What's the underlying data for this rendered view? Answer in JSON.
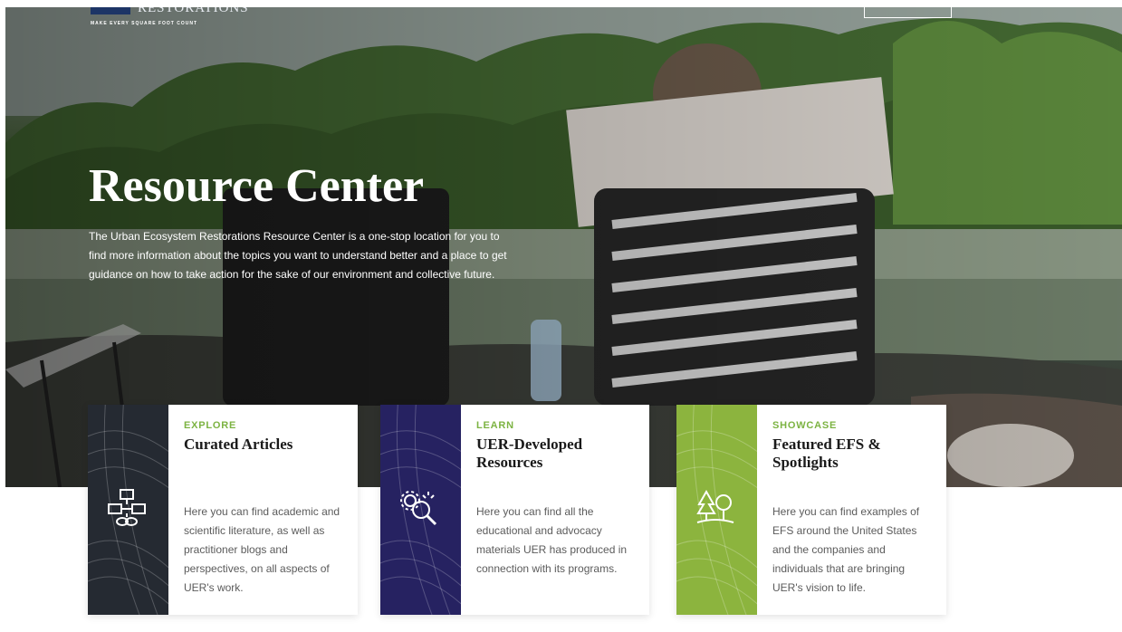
{
  "logo": {
    "wordmark": "RESTORATIONS",
    "tagline": "MAKE EVERY SQUARE FOOT COUNT"
  },
  "hero": {
    "title": "Resource Center",
    "description": "The Urban Ecosystem Restorations Resource Center is a one-stop location for you to find more information about the topics you want to understand better and a place to get guidance on how to take action for the sake of our environment and collective future."
  },
  "cards": [
    {
      "eyebrow": "EXPLORE",
      "title": "Curated Articles",
      "text": "Here you can find academic and scientific literature, as well as practitioner blogs and perspectives, on all aspects of UER's work.",
      "icon": "flowchart-icon",
      "color": "#252a32"
    },
    {
      "eyebrow": "LEARN",
      "title": "UER-Developed Resources",
      "text": "Here you can find all the educational and advocacy materials UER has produced in connection with its programs.",
      "icon": "gear-search-icon",
      "color": "#262261"
    },
    {
      "eyebrow": "SHOWCASE",
      "title": "Featured EFS & Spotlights",
      "text": "Here you can find examples of EFS around the United States and the companies and individuals that are bringing UER's vision to life.",
      "icon": "trees-icon",
      "color": "#8cb43e"
    }
  ],
  "colors": {
    "accent_green": "#7cb342",
    "brand_navy": "#1d3566"
  }
}
